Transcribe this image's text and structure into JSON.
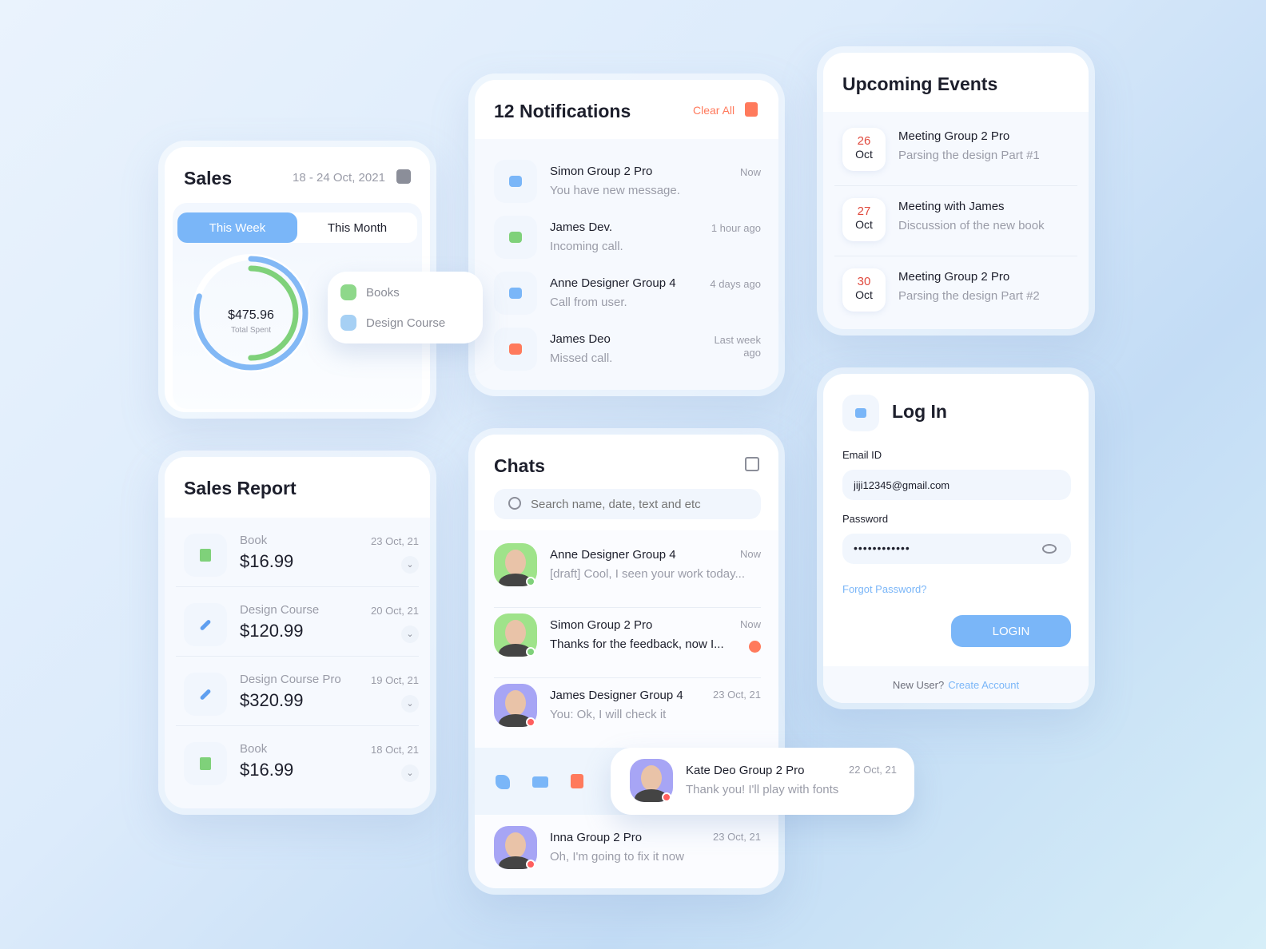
{
  "sales": {
    "title": "Sales",
    "date_range": "18 - 24 Oct, 2021",
    "tabs": [
      {
        "label": "This Week",
        "active": true
      },
      {
        "label": "This Month",
        "active": false
      }
    ],
    "total": "$475.96",
    "total_label": "Total Spent",
    "chart_data": {
      "type": "pie",
      "series": [
        {
          "name": "Books",
          "fraction": 0.5,
          "color": "#7fd17a"
        },
        {
          "name": "Design Course",
          "fraction": 0.8,
          "color": "#82b8f5"
        }
      ]
    }
  },
  "sales_report": {
    "title": "Sales Report",
    "items": [
      {
        "name": "Book",
        "price": "$16.99",
        "date": "23 Oct, 21",
        "icon": "book-icon"
      },
      {
        "name": "Design Course",
        "price": "$120.99",
        "date": "20 Oct, 21",
        "icon": "brush-icon"
      },
      {
        "name": "Design Course Pro",
        "price": "$320.99",
        "date": "19 Oct, 21",
        "icon": "brush-icon"
      },
      {
        "name": "Book",
        "price": "$16.99",
        "date": "18 Oct, 21",
        "icon": "book-icon"
      }
    ]
  },
  "notifications": {
    "title": "12 Notifications",
    "clear_all": "Clear All",
    "items": [
      {
        "name": "Simon Group 2 Pro",
        "text": "You have new message.",
        "time": "Now",
        "icon": "message-icon"
      },
      {
        "name": "James Dev.",
        "text": "Incoming call.",
        "time": "1 hour ago",
        "icon": "incoming-call-icon"
      },
      {
        "name": "Anne Designer Group 4",
        "text": "Call from user.",
        "time": "4 days ago",
        "icon": "user-add-icon"
      },
      {
        "name": "James Deo",
        "text": "Missed call.",
        "time": "Last week ago",
        "icon": "missed-call-icon"
      }
    ]
  },
  "chats": {
    "title": "Chats",
    "search_placeholder": "Search name, date, text and etc",
    "items": [
      {
        "name": "Anne Designer Group 4",
        "text": "[draft] Cool, I seen your work today...",
        "time": "Now",
        "status": "online",
        "avatar_bg": "#9fe38a"
      },
      {
        "name": "Simon Group 2 Pro",
        "text": "Thanks for the feedback, now I...",
        "time": "Now",
        "status": "online",
        "unread": true,
        "avatar_bg": "#9fe38a"
      },
      {
        "name": "James Designer Group 4",
        "text": "You: Ok, I will check it",
        "time": "23 Oct, 21",
        "status": "offline",
        "avatar_bg": "#a7a5f5"
      },
      {
        "name": "Kate Deo Group 2 Pro",
        "text": "Thank you! I'll play with fonts",
        "time": "22 Oct, 21",
        "status": "offline",
        "avatar_bg": "#a7a5f5"
      },
      {
        "name": "Inna Group 2 Pro",
        "text": "Oh, I'm going to fix it now",
        "time": "23 Oct, 21",
        "status": "offline",
        "avatar_bg": "#a7a5f5"
      }
    ]
  },
  "events": {
    "title": "Upcoming Events",
    "items": [
      {
        "day": "26",
        "month": "Oct",
        "title": "Meeting Group 2 Pro",
        "desc": "Parsing the design Part #1"
      },
      {
        "day": "27",
        "month": "Oct",
        "title": "Meeting with James",
        "desc": "Discussion of the new book"
      },
      {
        "day": "30",
        "month": "Oct",
        "title": "Meeting Group 2 Pro",
        "desc": "Parsing the design Part #2"
      }
    ]
  },
  "login": {
    "title": "Log In",
    "email_label": "Email ID",
    "email_value": "jiji12345@gmail.com",
    "password_label": "Password",
    "password_value": "••••••••••••",
    "forgot": "Forgot Password?",
    "button": "LOGIN",
    "new_user": "New User?",
    "create": "Create Account"
  },
  "colors": {
    "accent": "#7ab6f8",
    "danger": "#ff7a5c",
    "green": "#7fd17a"
  }
}
